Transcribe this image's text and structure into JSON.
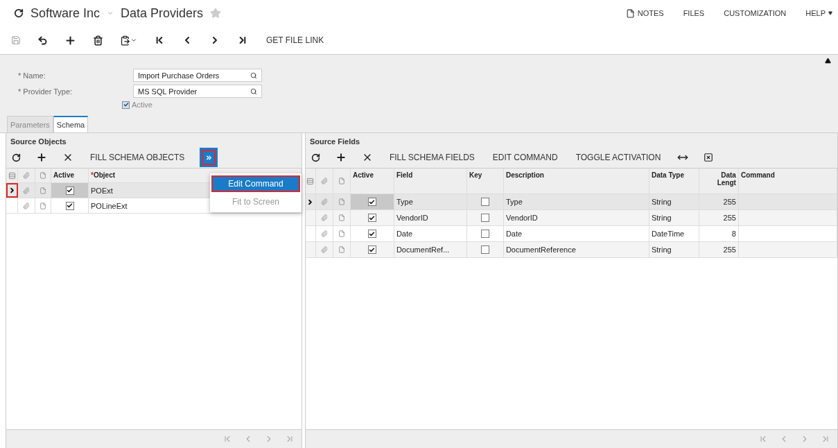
{
  "header": {
    "company": "Software Inc",
    "screen": "Data Providers",
    "links": [
      {
        "label": "NOTES",
        "kind": "notes"
      },
      {
        "label": "FILES",
        "kind": "plain"
      },
      {
        "label": "CUSTOMIZATION",
        "kind": "plain"
      },
      {
        "label": "HELP",
        "kind": "dropdown"
      }
    ]
  },
  "toolbar": {
    "action": "GET FILE LINK"
  },
  "form": {
    "fields": [
      {
        "label": "* Name:",
        "value": "Import Purchase Orders"
      },
      {
        "label": "* Provider Type:",
        "value": "MS SQL Provider"
      }
    ],
    "active": {
      "label": "Active",
      "checked": true
    }
  },
  "tabs": [
    {
      "label": "Parameters",
      "selected": false
    },
    {
      "label": "Schema",
      "selected": true
    }
  ],
  "source_objects": {
    "title": "Source Objects",
    "actions": [
      "FILL SCHEMA OBJECTS"
    ],
    "more_button": {
      "highlighted": true
    },
    "menu": [
      {
        "label": "Edit Command",
        "selected": true,
        "highlighted": true
      },
      {
        "label": "Fit to Screen",
        "selected": false,
        "highlighted": false
      }
    ],
    "columns": [
      {
        "label": "Active"
      },
      {
        "label": "Object",
        "marker": "*"
      }
    ],
    "rows": [
      {
        "active": true,
        "object": "POExt",
        "selected": true,
        "highlighted": true
      },
      {
        "active": true,
        "object": "POLineExt",
        "selected": false,
        "highlighted": false
      }
    ]
  },
  "source_fields": {
    "title": "Source Fields",
    "actions": [
      "FILL SCHEMA FIELDS",
      "EDIT COMMAND",
      "TOGGLE ACTIVATION"
    ],
    "columns": [
      "Active",
      "Field",
      "Key",
      "Description",
      "Data Type",
      "Data Lengt",
      "Command"
    ],
    "rows": [
      {
        "active": true,
        "field": "Type",
        "key": false,
        "description": "Type",
        "data_type": "String",
        "data_length": "255",
        "selected": true
      },
      {
        "active": true,
        "field": "VendorID",
        "key": false,
        "description": "VendorID",
        "data_type": "String",
        "data_length": "255",
        "selected": false
      },
      {
        "active": true,
        "field": "Date",
        "key": false,
        "description": "Date",
        "data_type": "DateTime",
        "data_length": "8",
        "selected": false
      },
      {
        "active": true,
        "field": "DocumentRef...",
        "key": false,
        "description": "DocumentReference",
        "data_type": "String",
        "data_length": "255",
        "selected": false
      }
    ]
  }
}
